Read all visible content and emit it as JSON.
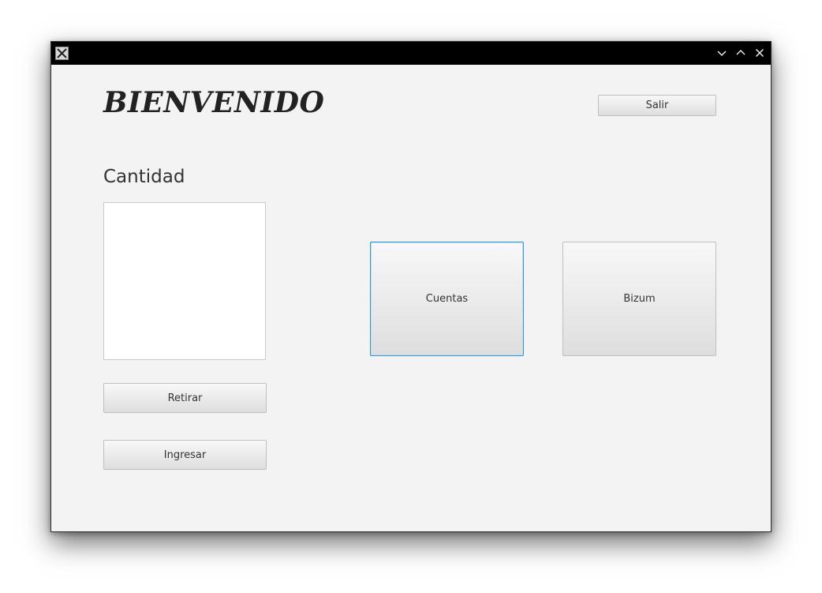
{
  "window": {
    "title": "",
    "controls": {
      "minimize_icon": "chevron-down-icon",
      "maximize_icon": "chevron-up-icon",
      "close_icon": "close-icon"
    }
  },
  "header": {
    "title": "BIENVENIDO",
    "exit_label": "Salir"
  },
  "amount": {
    "label": "Cantidad",
    "value": ""
  },
  "actions": {
    "withdraw_label": "Retirar",
    "deposit_label": "Ingresar",
    "accounts_label": "Cuentas",
    "bizum_label": "Bizum"
  },
  "colors": {
    "titlebar": "#000000",
    "background": "#f3f3f3",
    "focus_border": "#2a9ad8"
  }
}
